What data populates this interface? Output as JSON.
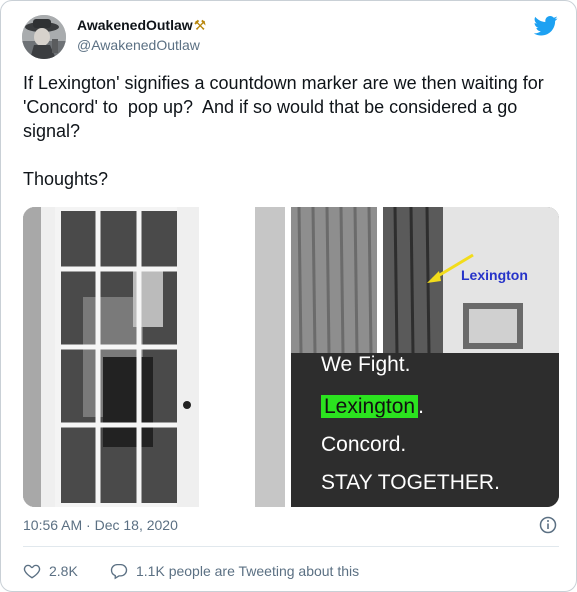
{
  "author": {
    "display_name": "AwakenedOutlaw",
    "emoji": "⚒",
    "handle": "@AwakenedOutlaw"
  },
  "tweet": {
    "text": "If Lexington' signifies a countdown marker are we then waiting for 'Concord' to  pop up?  And if so would that be considered a go signal?\n\nThoughts?",
    "timestamp": "10:56 AM · Dec 18, 2020"
  },
  "media": {
    "annotation_label": "Lexington",
    "line1": "We Fight.",
    "line2_highlight": "Lexington",
    "line2_suffix": ".",
    "line3": "Concord.",
    "line4": "STAY TOGETHER."
  },
  "engagement": {
    "likes": "2.8K",
    "talking": "1.1K people are Tweeting about this"
  },
  "colors": {
    "twitter_blue": "#1da1f2",
    "highlight_green": "#2be31f",
    "annotation_blue": "#2633c9",
    "arrow_yellow": "#f2dc1b"
  }
}
